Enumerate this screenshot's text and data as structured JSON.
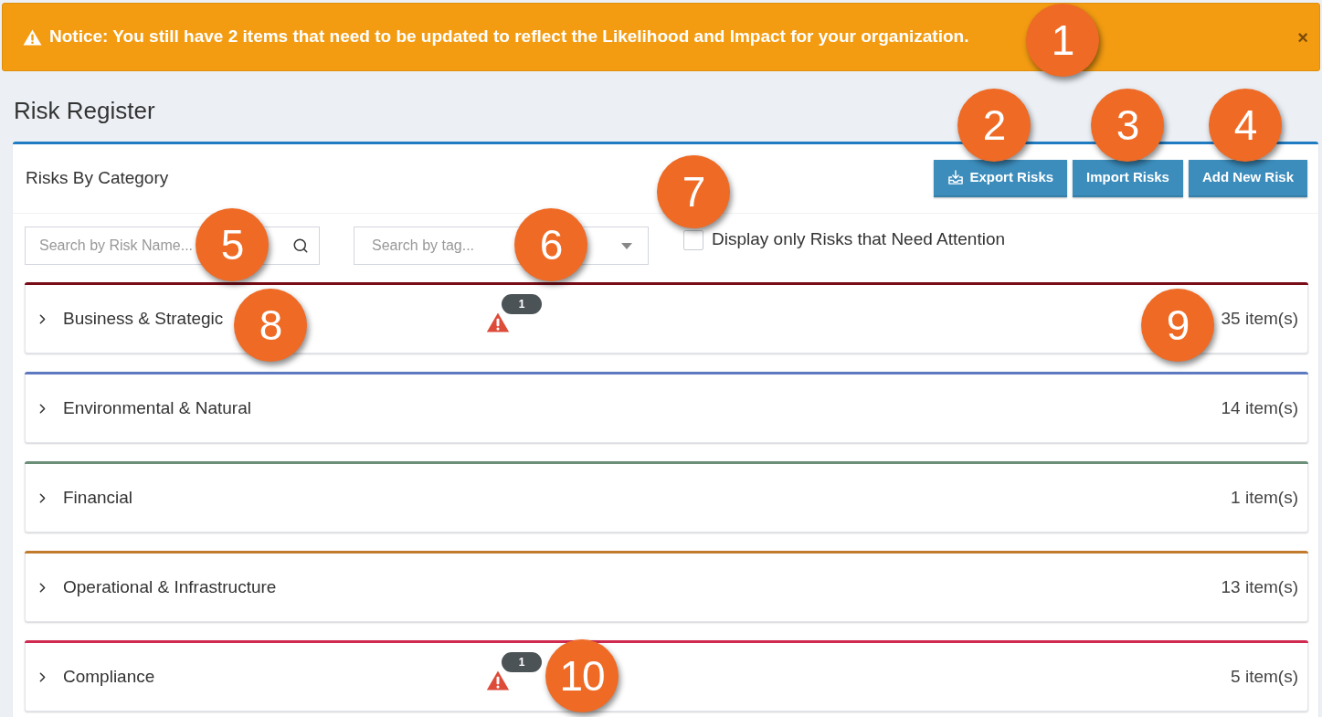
{
  "notice": {
    "text": "Notice: You still have 2 items that need to be updated to reflect the Likelihood and Impact for your organization.",
    "close": "×"
  },
  "page_title": "Risk Register",
  "card": {
    "title": "Risks By Category",
    "buttons": [
      {
        "label": "Export Risks",
        "kind": "icon"
      },
      {
        "label": "Import Risks",
        "kind": "text"
      },
      {
        "label": "Add New Risk",
        "kind": "text"
      }
    ]
  },
  "filters": {
    "name_search": {
      "placeholder": "Search by Risk Name..."
    },
    "tag_search": {
      "placeholder": "Search by tag..."
    },
    "attention_checkbox": {
      "label": "Display only Risks that Need Attention",
      "checked": false
    }
  },
  "categories": [
    {
      "name": "Business & Strategic",
      "count": "35 item(s)",
      "color": "#7a0c17",
      "alert_count": "1",
      "expanded": false
    },
    {
      "name": "Environmental & Natural",
      "count": "14 item(s)",
      "color": "#5d79c0",
      "expanded": false
    },
    {
      "name": "Financial",
      "count": "1 item(s)",
      "color": "#6b8f78",
      "expanded": false
    },
    {
      "name": "Operational & Infrastructure",
      "count": "13 item(s)",
      "color": "#c27a2c",
      "expanded": false
    },
    {
      "name": "Compliance",
      "count": "5 item(s)",
      "color": "#d02a50",
      "alert_count": "1",
      "expanded": false
    }
  ],
  "callouts": [
    "1",
    "2",
    "3",
    "4",
    "5",
    "6",
    "7",
    "8",
    "9",
    "10"
  ]
}
